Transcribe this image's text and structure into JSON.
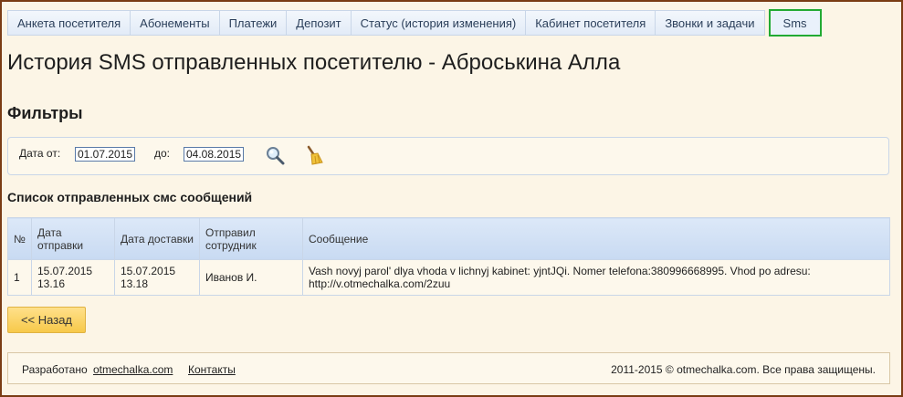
{
  "tabs": [
    {
      "label": "Анкета посетителя"
    },
    {
      "label": "Абонементы"
    },
    {
      "label": "Платежи"
    },
    {
      "label": "Депозит"
    },
    {
      "label": "Статус (история изменения)"
    },
    {
      "label": "Кабинет посетителя"
    },
    {
      "label": "Звонки и задачи"
    },
    {
      "label": "Sms",
      "active": true
    }
  ],
  "page": {
    "title": "История SMS отправленных посетителю - Аброськина Алла",
    "filters_title": "Фильтры",
    "list_title": "Список отправленных смс сообщений"
  },
  "filters": {
    "from_label": "Дата от:",
    "from_value": "01.07.2015",
    "to_label": "до:",
    "to_value": "04.08.2015",
    "search_icon": "magnifier-icon",
    "clear_icon": "broom-icon"
  },
  "table": {
    "headers": {
      "num": "№",
      "sent_date": "Дата отправки",
      "delivered_date": "Дата доставки",
      "sender": "Отправил сотрудник",
      "message": "Сообщение"
    },
    "rows": [
      {
        "num": "1",
        "sent_date": "15.07.2015",
        "sent_time": "13.16",
        "delivered_date": "15.07.2015",
        "delivered_time": "13.18",
        "sender": "Иванов И.",
        "message": "Vash novyj parol' dlya vhoda v lichnyj kabinet: yjntJQi. Nomer telefona:380996668995. Vhod po adresu: http://v.otmechalka.com/2zuu"
      }
    ]
  },
  "back_button": "<< Назад",
  "footer": {
    "developed_by": "Разработано",
    "developer_link": "otmechalka.com",
    "contacts_link": "Контакты",
    "copyright": "2011-2015 © otmechalka.com. Все права защищены."
  },
  "colors": {
    "background": "#fcf5e6",
    "frame_border": "#7a3c14",
    "tab_bg": "#e2ebf7",
    "active_tab_border": "#22aa33",
    "header_bg": "#c8daf2",
    "button_bg": "#f7c94a"
  }
}
